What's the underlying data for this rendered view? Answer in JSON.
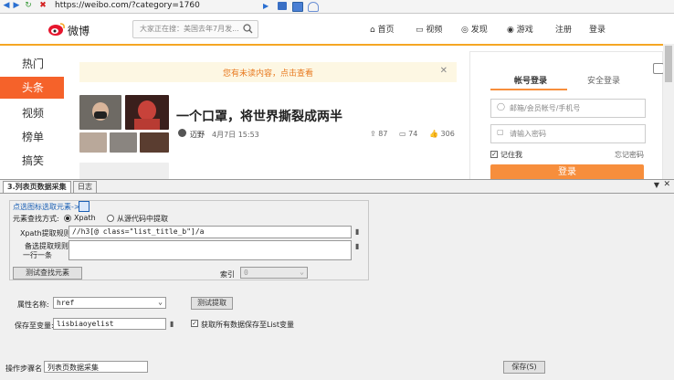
{
  "browser": {
    "url": "https://weibo.com/?category=1760",
    "icons": [
      "back-icon",
      "forward-icon",
      "refresh-icon",
      "stop-icon",
      "play-icon",
      "bookmark-icon",
      "mail-icon",
      "user-icon"
    ]
  },
  "weibo": {
    "logo_text": "微博",
    "search_placeholder": "大家正在搜：美国去年7月发...",
    "nav": {
      "home": "首页",
      "video": "视频",
      "discover": "发现",
      "game": "游戏",
      "register": "注册",
      "login": "登录"
    },
    "left_menu": [
      "热门",
      "头条",
      "视频",
      "榜单",
      "搞笑"
    ],
    "notice": "您有未读内容，点击查看",
    "feed": {
      "title": "一个口罩，将世界撕裂成两半",
      "author": "迈野",
      "date": "4月7日 15:53",
      "share": "87",
      "comment": "74",
      "like": "306"
    },
    "login_card": {
      "tab_account": "帐号登录",
      "tab_secure": "安全登录",
      "email_placeholder": "邮箱/会员帐号/手机号",
      "password_placeholder": "请输入密码",
      "remember": "记住我",
      "forgot": "忘记密码",
      "login_button": "登录"
    }
  },
  "tool": {
    "tab_active": "3.列表页数据采集",
    "tab_log": "日志",
    "hint_link": "点选图标选取元素->",
    "find_method_label": "元素查找方式:",
    "radio_xpath": "Xpath",
    "radio_source": "从源代码中提取",
    "xpath_rule_label": "Xpath提取规则",
    "xpath_rule_value": "//h3[@ class=\"list_title_b\"]/a",
    "backup_rule_label": "备选提取规则",
    "backup_rule_label2": "一行一条",
    "backup_rule_value": "",
    "test_find_button": "测试查找元素",
    "index_label": "索引",
    "index_value": "0",
    "attr_name_label": "属性名称:",
    "attr_name_value": "href",
    "test_extract_button": "测试提取",
    "save_var_label": "保存至变量:",
    "save_var_value": "lisbiaoyelist",
    "save_all_checkbox": "获取所有数据保存至List变量",
    "step_name_label": "操作步骤名",
    "step_name_value": "列表页数据采集",
    "save_button": "保存(S)"
  },
  "colors": {
    "weibo_orange": "#f5622a",
    "login_orange": "#f78e3c",
    "notice_text": "#e8791f",
    "link_blue": "#1a5fb4"
  }
}
